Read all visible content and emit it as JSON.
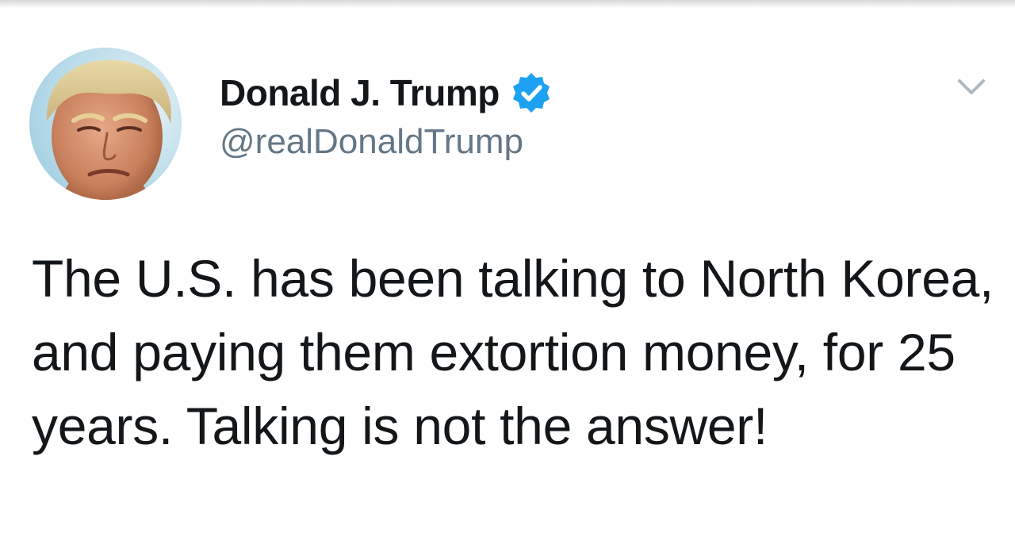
{
  "tweet": {
    "author": {
      "display_name": "Donald J. Trump",
      "handle": "@realDonaldTrump",
      "verified": true,
      "avatar_icon": "profile-photo"
    },
    "menu_icon": "chevron-down-icon",
    "text": "The U.S. has been talking to North Korea, and paying them extortion money, for 25 years. Talking is not the answer!"
  },
  "colors": {
    "text_primary": "#14171a",
    "text_secondary": "#657786",
    "verified_blue": "#1da1f2",
    "caret_gray": "#b0b8bf"
  }
}
